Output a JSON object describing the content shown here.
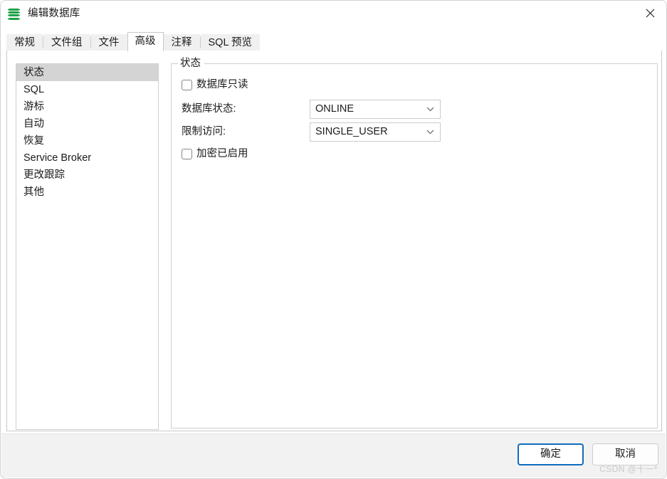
{
  "window": {
    "title": "编辑数据库",
    "icon": "database-icon",
    "close_label": "×"
  },
  "tabs": [
    {
      "label": "常规",
      "selected": false
    },
    {
      "label": "文件组",
      "selected": false
    },
    {
      "label": "文件",
      "selected": false
    },
    {
      "label": "高级",
      "selected": true
    },
    {
      "label": "注释",
      "selected": false
    },
    {
      "label": "SQL 预览",
      "selected": false
    }
  ],
  "sidebar": {
    "items": [
      {
        "label": "状态",
        "selected": true
      },
      {
        "label": "SQL",
        "selected": false
      },
      {
        "label": "游标",
        "selected": false
      },
      {
        "label": "自动",
        "selected": false
      },
      {
        "label": "恢复",
        "selected": false
      },
      {
        "label": "Service Broker",
        "selected": false
      },
      {
        "label": "更改跟踪",
        "selected": false
      },
      {
        "label": "其他",
        "selected": false
      }
    ]
  },
  "panel": {
    "group_title": "状态",
    "readonly_checkbox": {
      "label": "数据库只读",
      "checked": false
    },
    "db_state": {
      "label": "数据库状态:",
      "value": "ONLINE"
    },
    "restrict_access": {
      "label": "限制访问:",
      "value": "SINGLE_USER"
    },
    "encryption_checkbox": {
      "label": "加密已启用",
      "checked": false
    }
  },
  "footer": {
    "ok_label": "确定",
    "cancel_label": "取消",
    "watermark": "CSDN @十一*"
  },
  "colors": {
    "accent": "#0f6cbd",
    "icon_green": "#1faa4b",
    "selection_gray": "#d4d4d4",
    "footer_bg": "#f2f2f2",
    "tabstrip_bg": "#f0f0f0"
  }
}
